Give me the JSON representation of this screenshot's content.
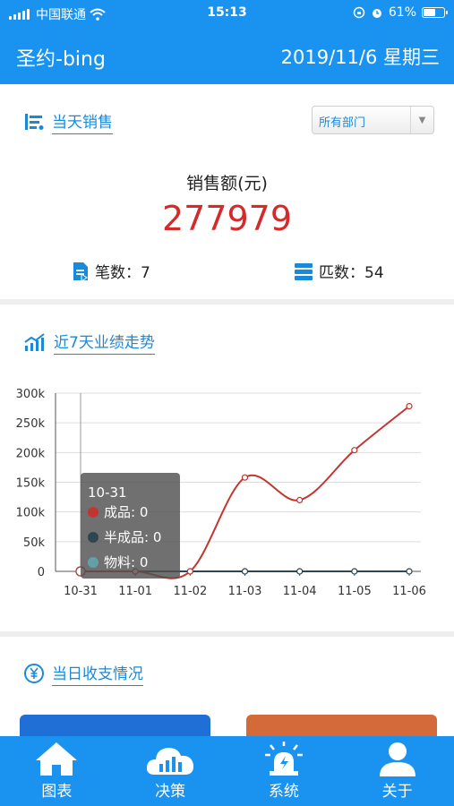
{
  "status_bar": {
    "carrier": "中国联通",
    "time": "15:13",
    "battery": "61%",
    "battery_level": 0.61
  },
  "header": {
    "title": "圣约-bing",
    "date": "2019/11/6 星期三"
  },
  "today_sales": {
    "title": "当天销售",
    "department_select": "所有部门",
    "amount_label": "销售额(元)",
    "amount_value": "277979",
    "count_label": "笔数：7",
    "pieces_label": "匹数：54"
  },
  "trend": {
    "title": "近7天业绩走势",
    "tooltip": {
      "date": "10-31",
      "rows": [
        {
          "text": "成品: 0",
          "color": "#c23531"
        },
        {
          "text": "半成品: 0",
          "color": "#2f4554"
        },
        {
          "text": "物料: 0",
          "color": "#61a0a8"
        }
      ]
    }
  },
  "chart_data": {
    "type": "line",
    "categories": [
      "10-31",
      "11-01",
      "11-02",
      "11-03",
      "11-04",
      "11-05",
      "11-06"
    ],
    "series": [
      {
        "name": "成品",
        "color": "#c23531",
        "values": [
          0,
          0,
          0,
          158000,
          120000,
          204000,
          278000
        ]
      },
      {
        "name": "半成品",
        "color": "#2f4554",
        "values": [
          0,
          0,
          0,
          0,
          0,
          0,
          0
        ]
      },
      {
        "name": "物料",
        "color": "#61a0a8",
        "values": [
          0,
          0,
          0,
          0,
          0,
          0,
          0
        ]
      }
    ],
    "ylim": [
      0,
      300000
    ],
    "ytick_labels": [
      "0",
      "50k",
      "100k",
      "150k",
      "200k",
      "250k",
      "300k"
    ],
    "grid": true
  },
  "income": {
    "title": "当日收支情况"
  },
  "tabbar": {
    "items": [
      {
        "label": "图表",
        "icon": "home-icon"
      },
      {
        "label": "决策",
        "icon": "cloud-chart-icon"
      },
      {
        "label": "系统",
        "icon": "alarm-icon"
      },
      {
        "label": "关于",
        "icon": "user-icon"
      }
    ]
  },
  "colors": {
    "primary": "#1a93f0",
    "accent_text": "#1a8ad8",
    "sales_value": "#d42a2a",
    "income_button": "#1f6fd6",
    "expense_button": "#d4693a"
  }
}
